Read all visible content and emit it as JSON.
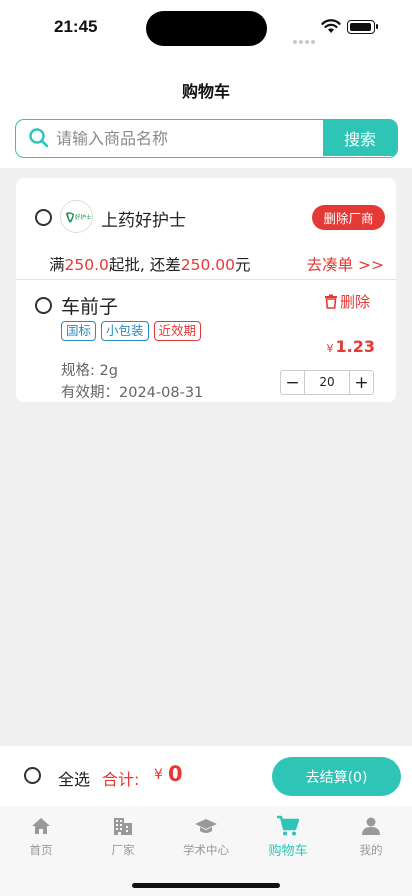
{
  "status_bar": {
    "time": "21:45"
  },
  "header": {
    "title": "购物车"
  },
  "search": {
    "placeholder": "请输入商品名称",
    "button_label": "搜索"
  },
  "vendor": {
    "name": "上药好护士",
    "logo_text": "好护士",
    "delete_label": "删除厂商",
    "min_order_prefix": "满",
    "min_order_amount": "250.0",
    "min_order_mid": "起批, 还差",
    "min_order_remaining": "250.00",
    "min_order_suffix": "元",
    "go_order_label": "去凑单 >>"
  },
  "product": {
    "name": "车前子",
    "delete_label": "删除",
    "tags": [
      "国标",
      "小包装",
      "近效期"
    ],
    "spec": "规格: 2g",
    "expiry": "有效期：2024-08-31",
    "currency": "¥",
    "price": "1.23",
    "quantity": "20",
    "minus": "−",
    "plus": "+"
  },
  "checkout": {
    "select_all_label": "全选",
    "total_label": "合计:",
    "currency": "¥",
    "total_value": "0",
    "checkout_label": "去结算(0)"
  },
  "tabs": [
    {
      "label": "首页",
      "icon": "home-icon",
      "active": false
    },
    {
      "label": "厂家",
      "icon": "building-icon",
      "active": false
    },
    {
      "label": "学术中心",
      "icon": "graduation-cap-icon",
      "active": false
    },
    {
      "label": "购物车",
      "icon": "cart-icon",
      "active": true
    },
    {
      "label": "我的",
      "icon": "user-icon",
      "active": false
    }
  ],
  "colors": {
    "accent": "#2ec4b6",
    "danger": "#e53935",
    "tag_blue": "#2e8bc0",
    "background": "#f0f0f0"
  }
}
